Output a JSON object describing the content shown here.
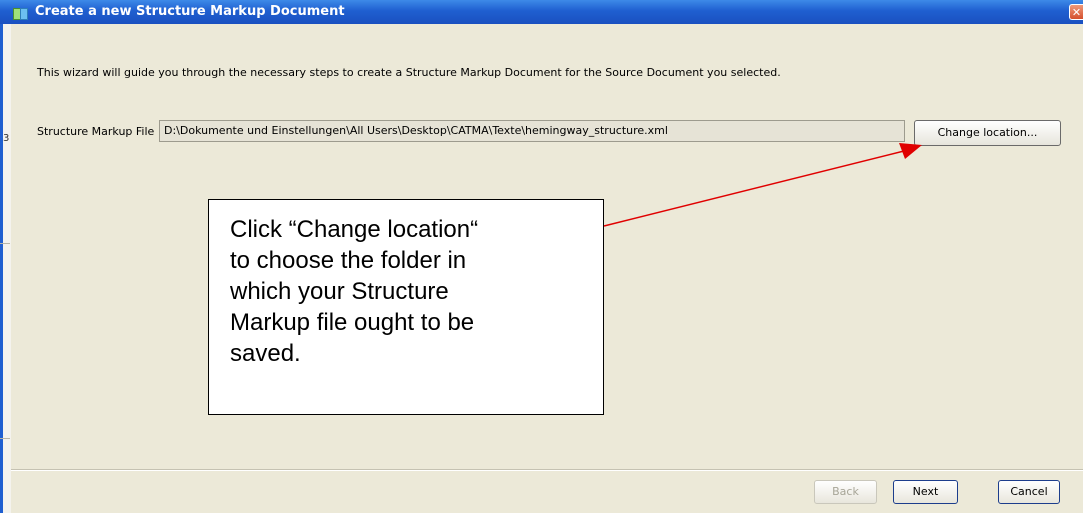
{
  "window": {
    "title": "Create a new Structure Markup Document",
    "app_icon": "catma-icon",
    "close_label": "✕"
  },
  "side_artifact": "3",
  "intro": "This wizard will guide you through the necessary steps to create a Structure Markup Document for the Source Document you selected.",
  "file_field": {
    "label": "Structure Markup File",
    "value": "D:\\Dokumente und Einstellungen\\All Users\\Desktop\\CATMA\\Texte\\hemingway_structure.xml",
    "change_label": "Change location..."
  },
  "callout": {
    "lines": [
      "Click “Change location“",
      "to choose the folder in",
      "which your Structure",
      "Markup file ought to be",
      "saved."
    ],
    "arrow_color": "#e00000"
  },
  "buttons": {
    "back": "Back",
    "next": "Next",
    "cancel": "Cancel"
  }
}
